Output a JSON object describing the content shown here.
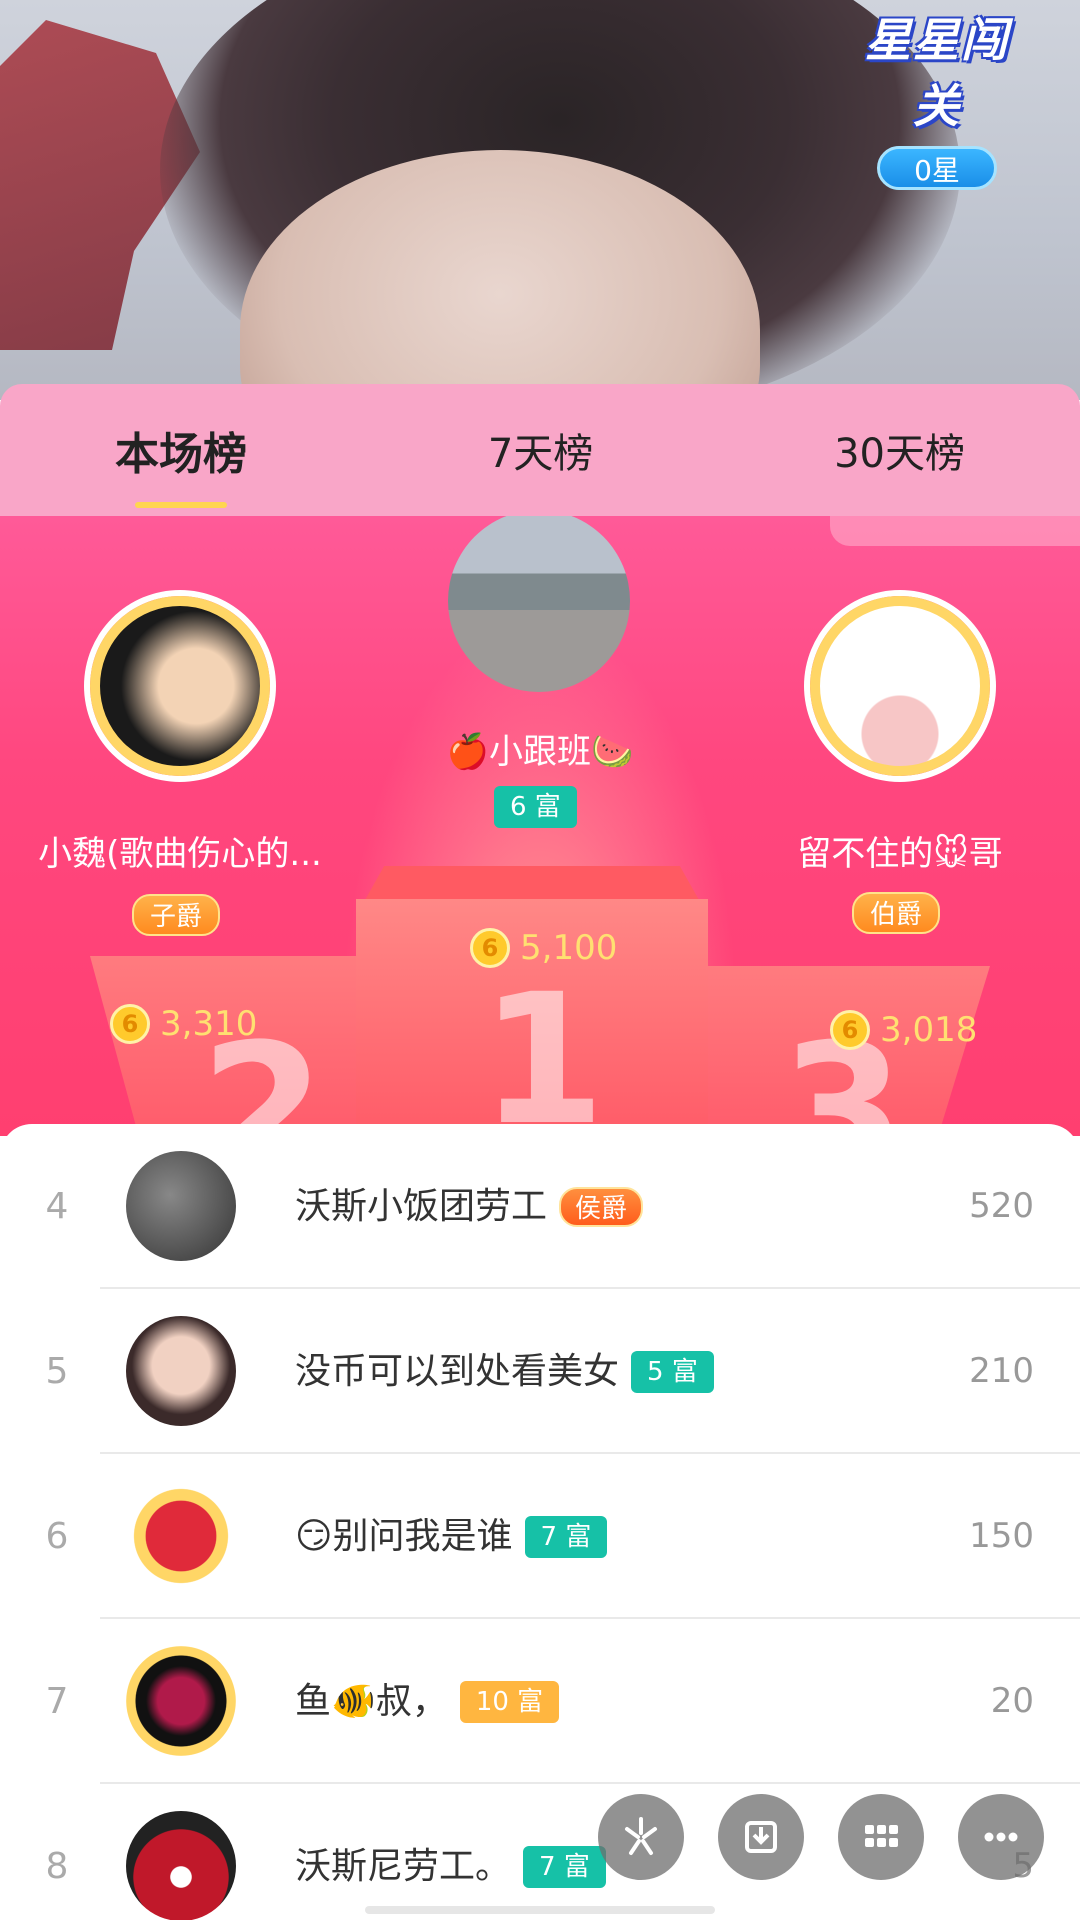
{
  "star_challenge": {
    "title": "星星闯关",
    "stars": "0星"
  },
  "tabs": [
    {
      "label": "本场榜"
    },
    {
      "label": "7天榜"
    },
    {
      "label": "30天榜"
    }
  ],
  "podium": {
    "first": {
      "name": "🍎小跟班🍉",
      "level": "6 富",
      "coins": "5,100",
      "numeral": "1"
    },
    "second": {
      "name": "小魏(歌曲伤心的...",
      "level": "子爵",
      "coins": "3,310",
      "numeral": "2"
    },
    "third": {
      "name": "留不住的🐭哥",
      "level": "伯爵",
      "coins": "3,018",
      "numeral": "3"
    },
    "coin_symbol": "6"
  },
  "rows": [
    {
      "rank": "4",
      "name": "沃斯小饭团劳工",
      "tag": "侯爵",
      "score": "520"
    },
    {
      "rank": "5",
      "name": "没币可以到处看美女",
      "tag": "5 富",
      "score": "210"
    },
    {
      "rank": "6",
      "name": "😏别问我是谁",
      "tag": "7 富",
      "score": "150"
    },
    {
      "rank": "7",
      "name": "鱼🐠叔，",
      "tag": "10 富",
      "score": "20"
    },
    {
      "rank": "8",
      "name": "沃斯尼劳工。",
      "tag": "7 富",
      "score": "5"
    }
  ],
  "fab_icons": [
    "share-icon",
    "download-icon",
    "grid-icon",
    "more-icon"
  ],
  "colors": {
    "pink": "#ff4f85",
    "teal": "#16c1a7",
    "gold": "#ffd666",
    "tab_bg": "#f9a6c8"
  }
}
